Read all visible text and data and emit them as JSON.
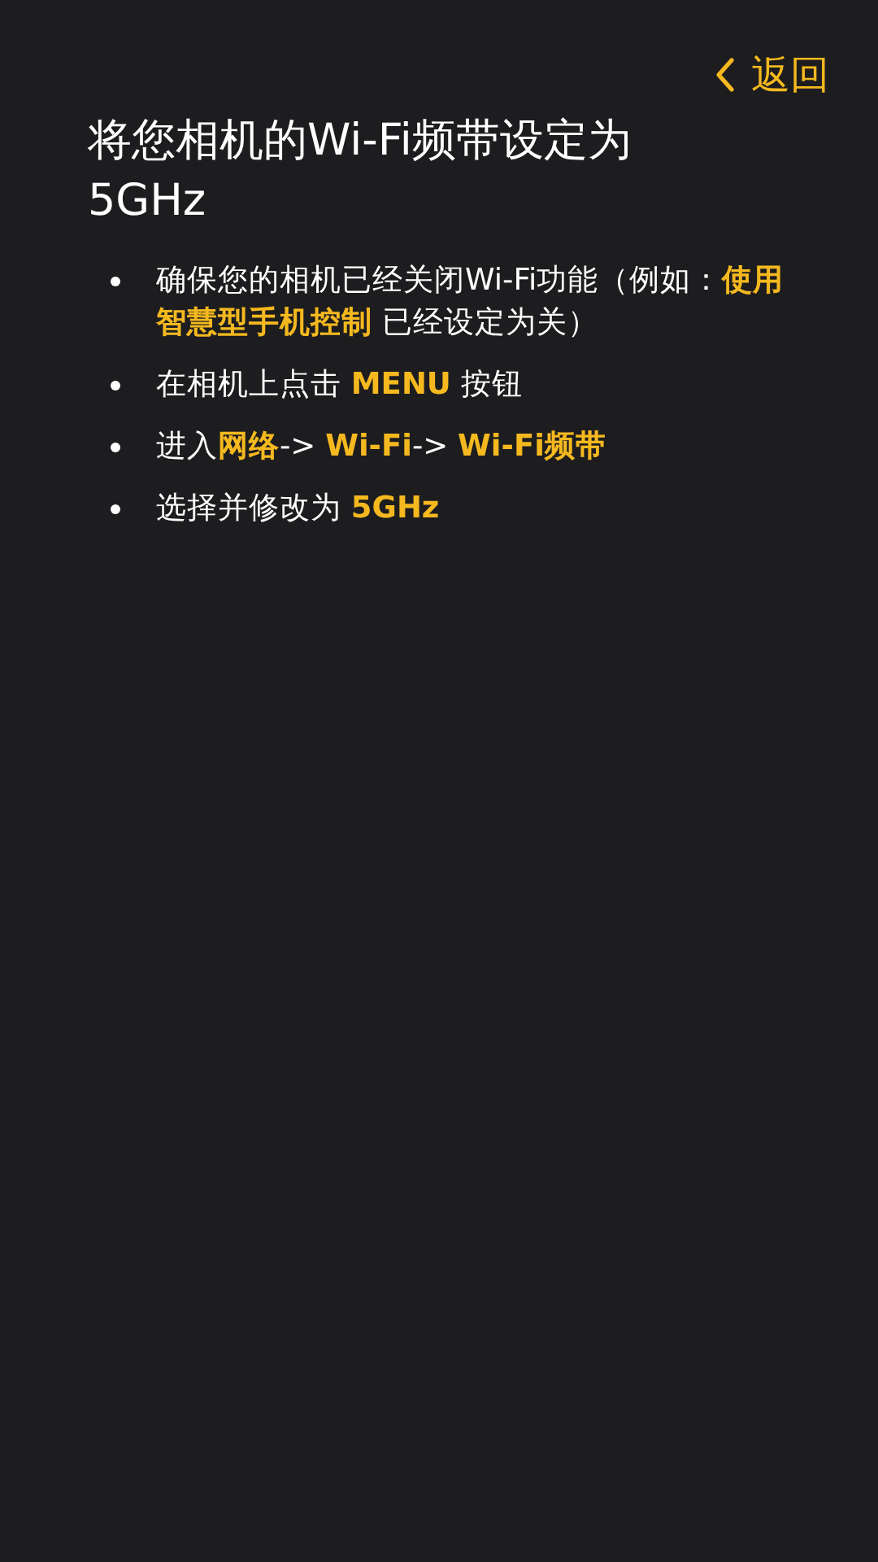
{
  "back_button": {
    "label": "返回"
  },
  "title": "将您相机的Wi-Fi频带设定为5GHz",
  "steps": [
    {
      "text": "确保您的相机已经关闭Wi-Fi功能（例如：**使用智慧型手机控制** 已经设定为关）"
    },
    {
      "text": "在相机上点击 **MENU** 按钮"
    },
    {
      "text": "进入**网络**-> **Wi-Fi**-> **Wi-Fi频带**"
    },
    {
      "text": "选择并修改为 **5GHz**"
    }
  ]
}
